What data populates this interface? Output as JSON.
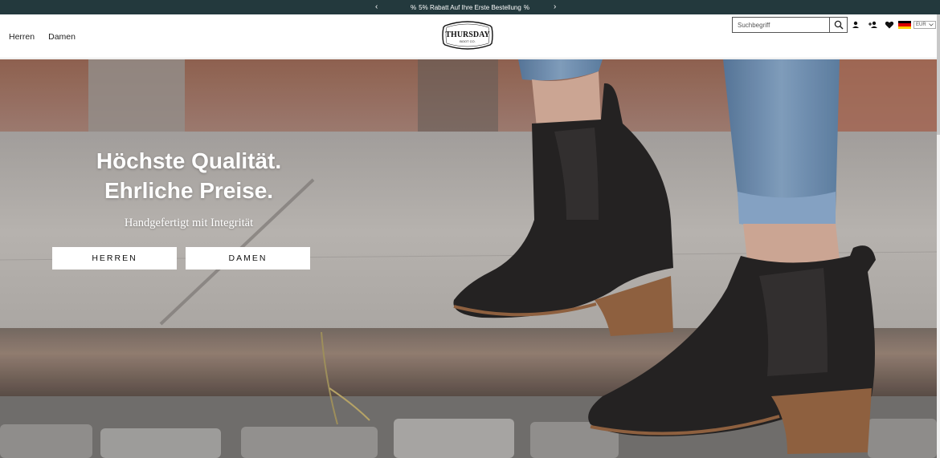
{
  "announcement": {
    "text": "5% Rabatt Auf Ihre Erste Bestellung",
    "prev_icon": "chevron-left-icon",
    "next_icon": "chevron-right-icon",
    "background": "#23393d"
  },
  "nav": {
    "items": [
      {
        "label": "Herren"
      },
      {
        "label": "Damen"
      }
    ]
  },
  "logo": {
    "line1": "THURSDAY",
    "line2": "BOOT CO."
  },
  "search": {
    "placeholder": "Suchbegriff",
    "icon": "search-icon"
  },
  "header_icons": [
    "account-icon",
    "add-user-icon",
    "heart-icon"
  ],
  "locale": {
    "flag": "germany-flag-icon",
    "currency": "EUR"
  },
  "hero": {
    "title_line1": "Höchste Qualität.",
    "title_line2": "Ehrliche Preise.",
    "subtitle": "Handgefertigt mit Integrität",
    "buttons": [
      {
        "label": "HERREN"
      },
      {
        "label": "DAMEN"
      }
    ]
  }
}
